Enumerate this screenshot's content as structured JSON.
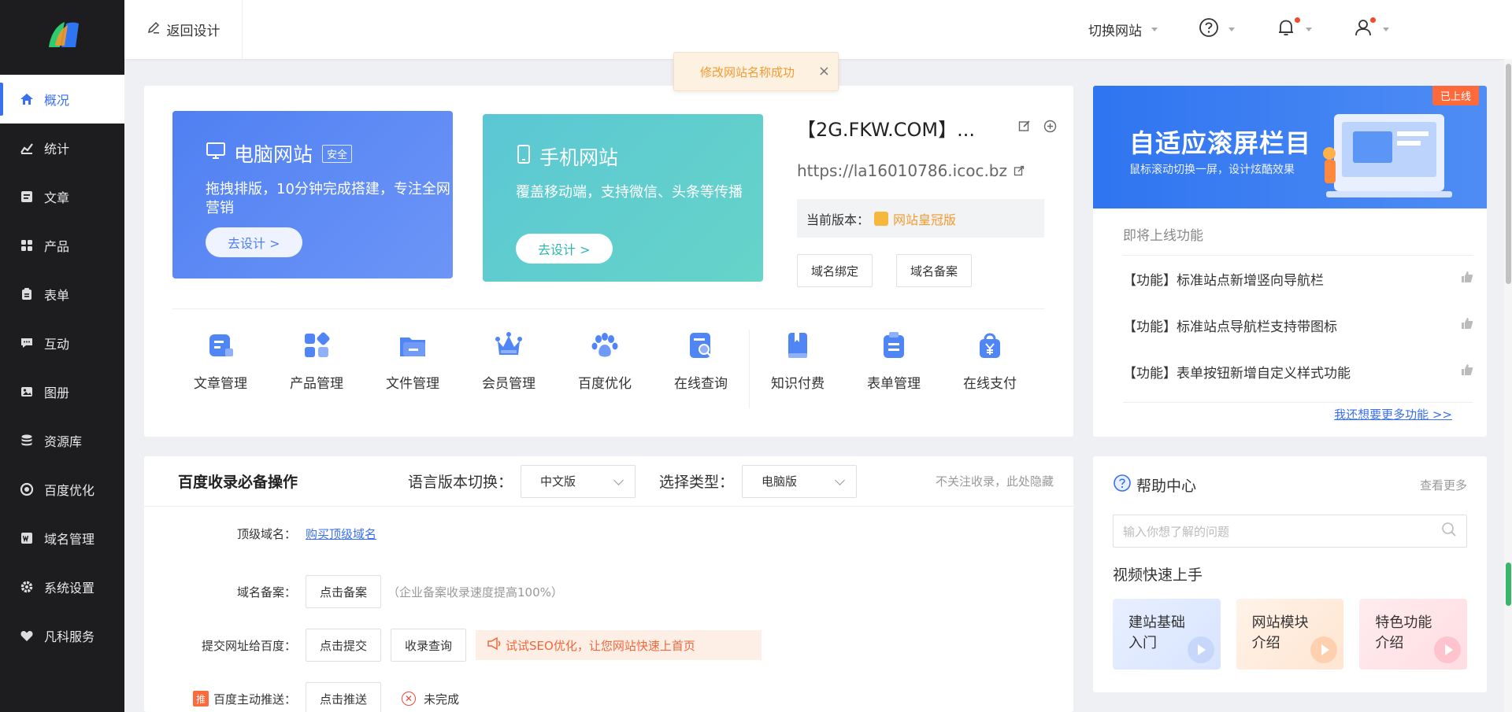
{
  "topbar": {
    "back_label": "返回设计",
    "switch_site": "切换网站"
  },
  "toast": {
    "message": "修改网站名称成功"
  },
  "sidebar": {
    "items": [
      {
        "label": "概况",
        "icon": "home-icon"
      },
      {
        "label": "统计",
        "icon": "chart-icon"
      },
      {
        "label": "文章",
        "icon": "article-icon"
      },
      {
        "label": "产品",
        "icon": "grid-icon"
      },
      {
        "label": "表单",
        "icon": "form-icon"
      },
      {
        "label": "互动",
        "icon": "chat-icon"
      },
      {
        "label": "图册",
        "icon": "gallery-icon"
      },
      {
        "label": "资源库",
        "icon": "database-icon"
      },
      {
        "label": "百度优化",
        "icon": "baidu-icon"
      },
      {
        "label": "域名管理",
        "icon": "domain-icon"
      },
      {
        "label": "系统设置",
        "icon": "gear-icon"
      },
      {
        "label": "凡科服务",
        "icon": "heart-icon"
      }
    ]
  },
  "pc_site": {
    "title": "电脑网站",
    "tag": "安全",
    "desc": "拖拽排版，10分钟完成搭建，专注全网营销",
    "button": "去设计 >"
  },
  "mobile_site": {
    "title": "手机网站",
    "desc": "覆盖移动端，支持微信、头条等传播",
    "button": "去设计 >"
  },
  "site_info": {
    "name": "【2G.FKW.COM】...",
    "url": "https://la16010786.icoc.bz",
    "version_label": "当前版本：",
    "version_value": "网站皇冠版",
    "bind_btn": "域名绑定",
    "record_btn": "域名备案"
  },
  "tools": [
    {
      "label": "文章管理",
      "icon": "article-manage-icon"
    },
    {
      "label": "产品管理",
      "icon": "product-manage-icon"
    },
    {
      "label": "文件管理",
      "icon": "folder-icon"
    },
    {
      "label": "会员管理",
      "icon": "crown-icon"
    },
    {
      "label": "百度优化",
      "icon": "paw-icon"
    },
    {
      "label": "在线查询",
      "icon": "search-doc-icon"
    },
    {
      "label": "知识付费",
      "icon": "book-icon"
    },
    {
      "label": "表单管理",
      "icon": "clipboard-icon"
    },
    {
      "label": "在线支付",
      "icon": "payment-bag-icon"
    }
  ],
  "promo": {
    "badge": "已上线",
    "title": "自适应滚屏栏目",
    "subtitle": "鼠标滚动切换一屏，设计炫酷效果",
    "upcoming_title": "即将上线功能",
    "features": [
      "【功能】标准站点新增竖向导航栏",
      "【功能】标准站点导航栏支持带图标",
      "【功能】表单按钮新增自定义样式功能"
    ],
    "more": "我还想要更多功能 >>"
  },
  "baidu": {
    "title": "百度收录必备操作",
    "lang_label": "语言版本切换：",
    "lang_value": "中文版",
    "type_label": "选择类型：",
    "type_value": "电脑版",
    "hide": "不关注收录，此处隐藏",
    "rows": {
      "top_domain_label": "顶级域名：",
      "top_domain_link": "购买顶级域名",
      "record_label": "域名备案：",
      "record_btn": "点击备案",
      "record_hint": "（企业备案收录速度提高100%）",
      "submit_label": "提交网址给百度：",
      "submit_btn": "点击提交",
      "query_btn": "收录查询",
      "seo_tip": "试试SEO优化，让您网站快速上首页",
      "push_tag": "推",
      "push_label": "百度主动推送：",
      "push_btn": "点击推送",
      "push_status": "未完成"
    }
  },
  "help": {
    "title": "帮助中心",
    "more": "查看更多",
    "search_placeholder": "输入你想了解的问题",
    "video_title": "视频快速上手",
    "videos": [
      {
        "line1": "建站基础",
        "line2": "入门"
      },
      {
        "line1": "网站模块",
        "line2": "介绍"
      },
      {
        "line1": "特色功能",
        "line2": "介绍"
      }
    ]
  }
}
